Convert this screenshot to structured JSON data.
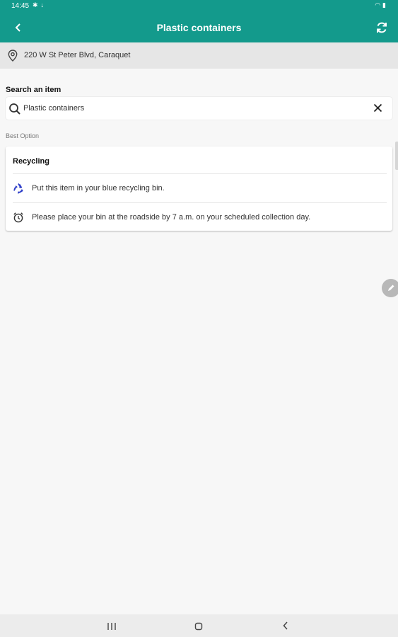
{
  "status_bar": {
    "time": "14:45"
  },
  "app_bar": {
    "title": "Plastic containers",
    "background_color": "#139a8c"
  },
  "location": {
    "address": "220 W St Peter Blvd, Caraquet"
  },
  "search": {
    "label": "Search an item",
    "value": "Plastic containers"
  },
  "result": {
    "section_label": "Best Option",
    "title": "Recycling",
    "rows": [
      {
        "icon": "recycle-icon",
        "text": "Put this item in your blue recycling bin."
      },
      {
        "icon": "alarm-clock-icon",
        "text": "Please place your bin at the roadside by 7 a.m. on your scheduled collection day."
      }
    ]
  },
  "colors": {
    "recycle_blue": "#2f3fc9"
  }
}
